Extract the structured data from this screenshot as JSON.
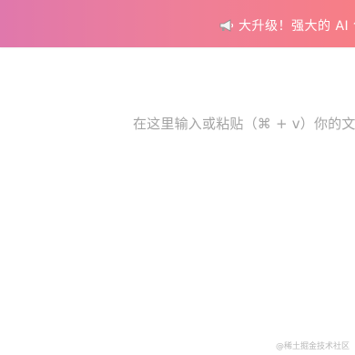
{
  "banner": {
    "icon": "megaphone-icon",
    "text": "大升级！强大的 AI 创",
    "gradient_colors": [
      "#e078ac",
      "#f77e86"
    ]
  },
  "editor": {
    "placeholder": "在这里输入或粘贴（⌘ + v）你的文"
  },
  "watermark": {
    "text": "@稀土掘金技术社区"
  }
}
